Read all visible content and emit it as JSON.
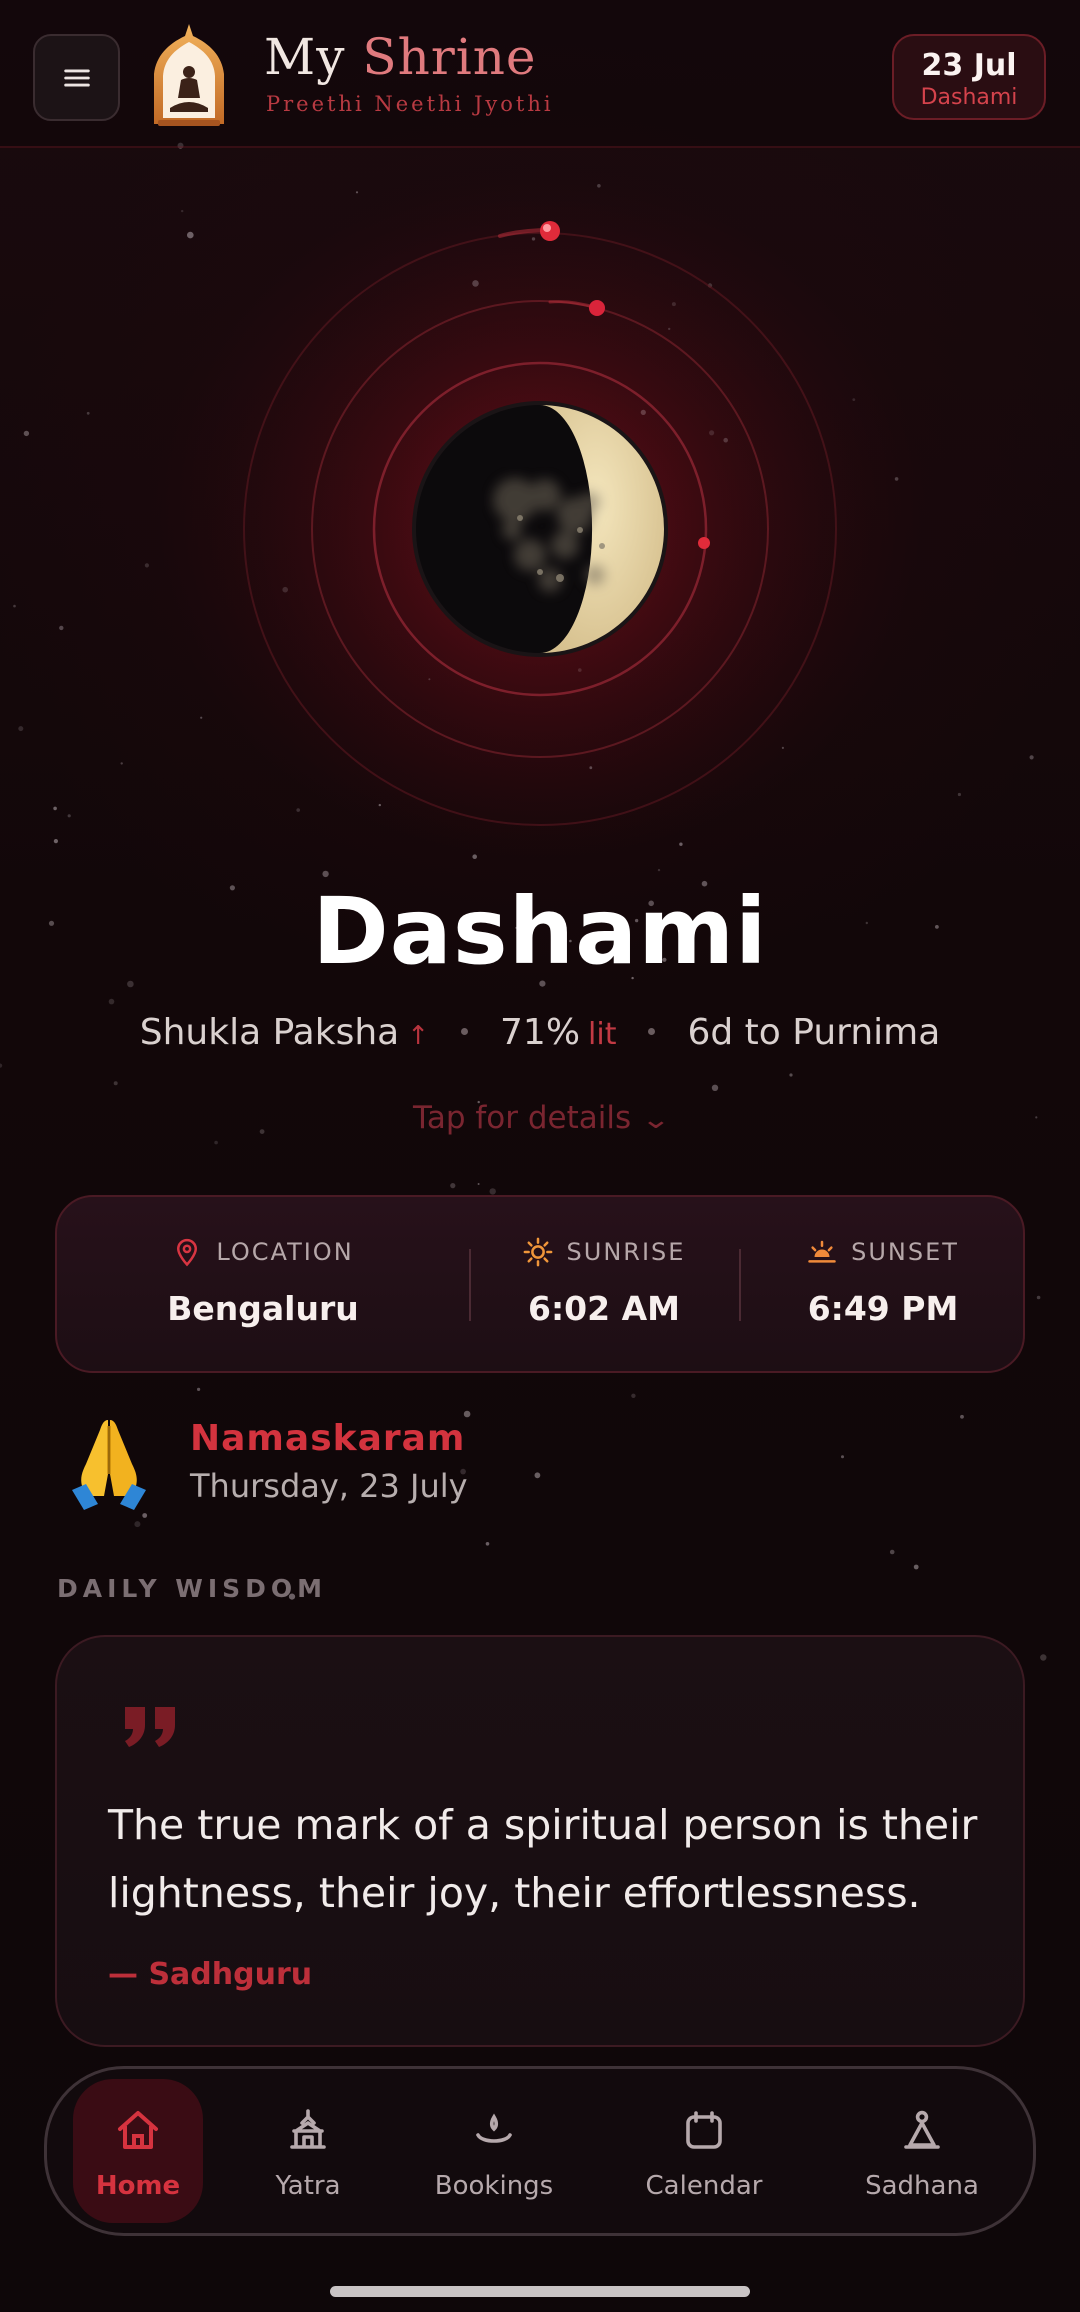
{
  "header": {
    "title_part1": "My",
    "title_part2": "Shrine",
    "subtitle": "Preethi Neethi Jyothi",
    "date": "23 Jul",
    "date_tithi": "Dashami"
  },
  "moon": {
    "illumination_fraction": 0.71,
    "phase_name": "Dashami",
    "paksha": "Shukla Paksha",
    "paksha_arrow": "↑",
    "lit_percent": "71%",
    "lit_word": "lit",
    "to_next": "6d to Purnima",
    "details_label": "Tap for details"
  },
  "info": {
    "location_label": "LOCATION",
    "location_value": "Bengaluru",
    "sunrise_label": "SUNRISE",
    "sunrise_value": "6:02 AM",
    "sunset_label": "SUNSET",
    "sunset_value": "6:49 PM"
  },
  "greeting": {
    "title": "Namaskaram",
    "date": "Thursday, 23 July"
  },
  "wisdom": {
    "section_label": "DAILY WISDOM",
    "quote": "The true mark of a spiritual person is their lightness, their joy, their effortlessness.",
    "author": "— Sadhguru"
  },
  "nav": {
    "items": [
      {
        "label": "Home",
        "icon": "home-icon",
        "active": true
      },
      {
        "label": "Yatra",
        "icon": "temple-icon",
        "active": false
      },
      {
        "label": "Bookings",
        "icon": "diya-icon",
        "active": false
      },
      {
        "label": "Calendar",
        "icon": "calendar-icon",
        "active": false
      },
      {
        "label": "Sadhana",
        "icon": "meditation-icon",
        "active": false
      }
    ]
  },
  "colors": {
    "accent": "#d3333e",
    "background": "#120709",
    "moon_lit": "#e8d6a8"
  }
}
